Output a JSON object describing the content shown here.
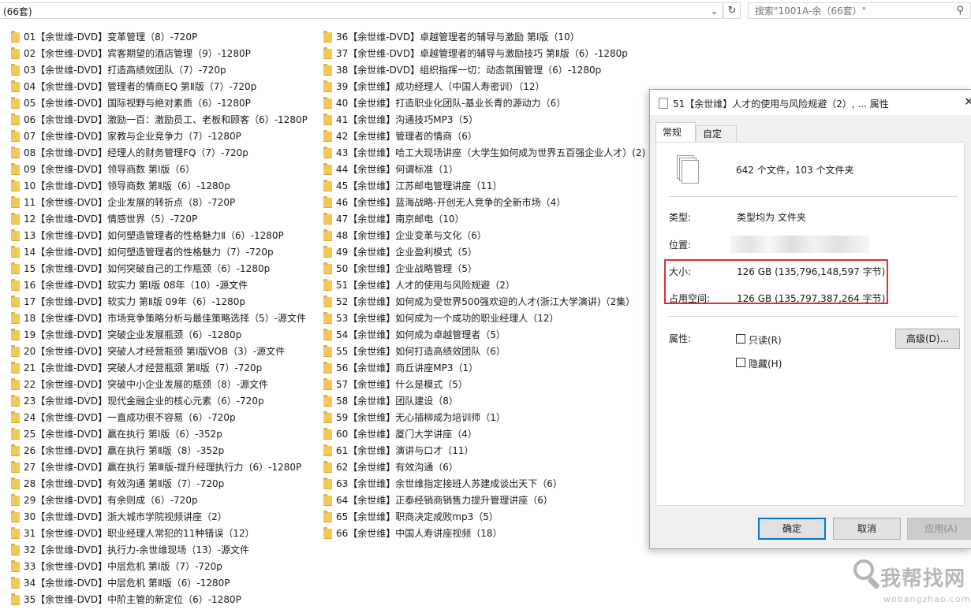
{
  "explorer": {
    "path_text": "(66套)",
    "search_placeholder": "搜索\"1001A-余（66套）\"",
    "folders_col1": [
      "01【余世维-DVD】变革管理（8）-720P",
      "02【余世维-DVD】宾客期望的酒店管理（9）-1280P",
      "03【余世维-DVD】打造高绩效团队（7）-720p",
      "04【余世维-DVD】管理者的情商EQ 第Ⅱ版（7）-720p",
      "05【余世维-DVD】国际视野与绝对素质（6）-1280P",
      "06【余世维-DVD】激励一百：激励员工、老板和顾客（6）-1280P",
      "07【余世维-DVD】家教与企业竞争力（7）-1280P",
      "08【余世维-DVD】经理人的财务管理FQ（7）-720p",
      "09【余世维-DVD】领导商数 第Ⅰ版（6）",
      "10【余世维-DVD】领导商数 第Ⅱ版（6）-1280p",
      "11【余世维-DVD】企业发展的转折点（8）-720P",
      "12【余世维-DVD】情感世界（5）-720P",
      "13【余世维-DVD】如何塑造管理者的性格魅力Ⅱ（6）-1280P",
      "14【余世维-DVD】如何塑造管理者的性格魅力（7）-720p",
      "15【余世维-DVD】如何突破自己的工作瓶颈（6）-1280p",
      "16【余世维-DVD】软实力 第Ⅰ版 08年（10）-源文件",
      "17【余世维-DVD】软实力 第Ⅱ版 09年（6）-1280p",
      "18【余世维-DVD】市场竞争策略分析与最佳策略选择（5）-源文件",
      "19【余世维-DVD】突破企业发展瓶颈（6）-1280p",
      "20【余世维-DVD】突破人才经营瓶颈 第Ⅰ版VOB（3）-源文件",
      "21【余世维-DVD】突破人才经营瓶颈 第Ⅱ版（7）-720p",
      "22【余世维-DVD】突破中小企业发展的瓶颈（8）-源文件",
      "23【余世维-DVD】现代金融企业的核心元素（6）-720p",
      "24【余世维-DVD】一直成功很不容易（6）-720p",
      "25【余世维-DVD】赢在执行 第Ⅰ版（6）-352p",
      "26【余世维-DVD】赢在执行 第Ⅱ版（8）-352p",
      "27【余世维-DVD】赢在执行 第Ⅲ版-提升经理执行力（6）-1280P",
      "28【余世维-DVD】有效沟通 第Ⅱ版（7）-720p",
      "29【余世维-DVD】有余则成（6）-720p",
      "30【余世维-DVD】浙大城市学院视频讲座（2）",
      "31【余世维-DVD】职业经理人常犯的11种错误（12）",
      "32【余世维-DVD】执行力-余世维现场（13）-源文件",
      "33【余世维-DVD】中层危机 第Ⅰ版（7）-720p",
      "34【余世维-DVD】中层危机 第Ⅱ版（6）-1280P",
      "35【余世维-DVD】中阶主管的新定位（6）-1280P"
    ],
    "folders_col2": [
      "36【余世维-DVD】卓越管理者的辅导与激励 第Ⅰ版（10）",
      "37【余世维-DVD】卓越管理者的辅导与激励技巧 第Ⅱ版（6）-1280p",
      "38【余世维-DVD】组织指挥一切：动态氛围管理（6）-1280p",
      "39【余世维】成功经理人（中国人寿密训）（12）",
      "40【余世维】打造职业化团队-基业长青的源动力（6）",
      "41【余世维】沟通技巧MP3（5）",
      "42【余世维】管理者的情商（6）",
      "43【余世维】哈工大现场讲座（大学生如何成为世界五百强企业人才）(2)",
      "44【余世维】何谓标准（1）",
      "45【余世维】江苏邮电管理讲座（11）",
      "46【余世维】蓝海战略-开创无人竞争的全新市场（4）",
      "47【余世维】南京邮电（10）",
      "48【余世维】企业变革与文化（6）",
      "49【余世维】企业盈利模式（5）",
      "50【余世维】企业战略管理（5）",
      "51【余世维】人才的使用与风险规避（2）",
      "52【余世维】如何成为受世界500强欢迎的人才(浙江大学演讲)（2集）",
      "53【余世维】如何成为一个成功的职业经理人（12）",
      "54【余世维】如何成为卓越管理者（5）",
      "55【余世维】如何打造高绩效团队（6）",
      "56【余世维】商丘讲座MP3（1）",
      "57【余世维】什么是模式（5）",
      "58【余世维】团队建设（8）",
      "59【余世维】无心插柳成为培训师（1）",
      "60【余世维】厦门大学讲座（4）",
      "61【余世维】演讲与口才（11）",
      "62【余世维】有效沟通（6）",
      "63【余世维】余世维指定接班人苏建成谈出天下（6）",
      "64【余世维】正泰经销商销售力提升管理讲座（6）",
      "65【余世维】职商决定成败mp3（5）",
      "66【余世维】中国人寿讲座视频（18）"
    ]
  },
  "dialog": {
    "title": "51【余世维】人才的使用与风险规避（2）, ... 属性",
    "tabs": [
      "常规",
      "自定义"
    ],
    "summary": "642 个文件，103 个文件夹",
    "type_label": "类型:",
    "type_value": "类型均为 文件夹",
    "location_label": "位置:",
    "size_label": "大小:",
    "size_value": "126 GB (135,796,148,597 字节)",
    "disk_label": "占用空间:",
    "disk_value": "126 GB (135,797,387,264 字节)",
    "attrs_label": "属性:",
    "readonly_label": "只读(R)",
    "hidden_label": "隐藏(H)",
    "advanced_label": "高级(D)...",
    "ok_label": "确定",
    "cancel_label": "取消",
    "apply_label": "应用(A)"
  },
  "watermark": {
    "main": "我帮找网",
    "sub": "wobangzhao.com"
  }
}
